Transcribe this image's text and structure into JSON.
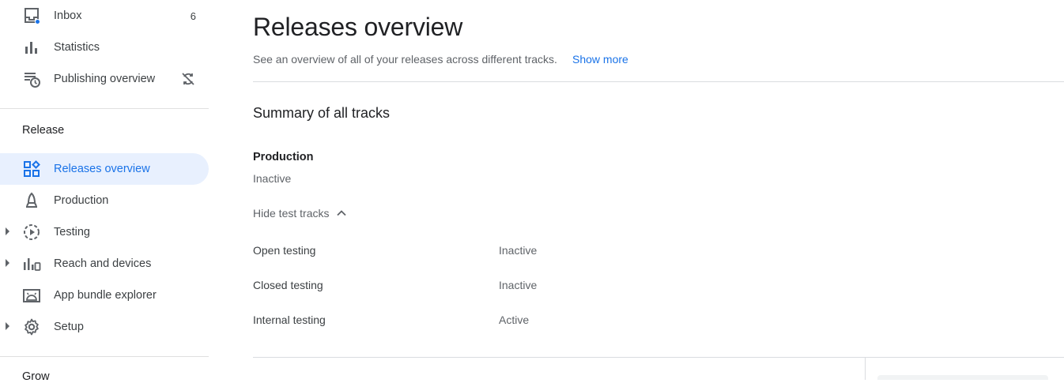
{
  "sidebar": {
    "items_top": [
      {
        "label": "Inbox",
        "icon": "inbox-icon",
        "count": "6"
      },
      {
        "label": "Statistics",
        "icon": "bar-chart-icon"
      },
      {
        "label": "Publishing overview",
        "icon": "publishing-overview-icon",
        "trail_icon": "sync-disabled-icon"
      }
    ],
    "section_release": "Release",
    "items_release": [
      {
        "label": "Releases overview",
        "icon": "dashboard-icon",
        "active": true
      },
      {
        "label": "Production",
        "icon": "production-icon"
      },
      {
        "label": "Testing",
        "icon": "testing-icon",
        "expandable": true
      },
      {
        "label": "Reach and devices",
        "icon": "reach-devices-icon",
        "expandable": true
      },
      {
        "label": "App bundle explorer",
        "icon": "android-icon"
      },
      {
        "label": "Setup",
        "icon": "gear-icon",
        "expandable": true
      }
    ],
    "section_grow": "Grow"
  },
  "main": {
    "title": "Releases overview",
    "description": "See an overview of all of your releases across different tracks.",
    "show_more": "Show more",
    "summary_title": "Summary of all tracks",
    "production": {
      "name": "Production",
      "status": "Inactive"
    },
    "toggle_label": "Hide test tracks",
    "test_tracks": [
      {
        "name": "Open testing",
        "status": "Inactive"
      },
      {
        "name": "Closed testing",
        "status": "Inactive"
      },
      {
        "name": "Internal testing",
        "status": "Active"
      }
    ]
  },
  "colors": {
    "accent": "#1a73e8",
    "active_bg": "#e8f0fe",
    "text_primary": "#202124",
    "text_secondary": "#5f6368",
    "divider": "#dadce0"
  }
}
